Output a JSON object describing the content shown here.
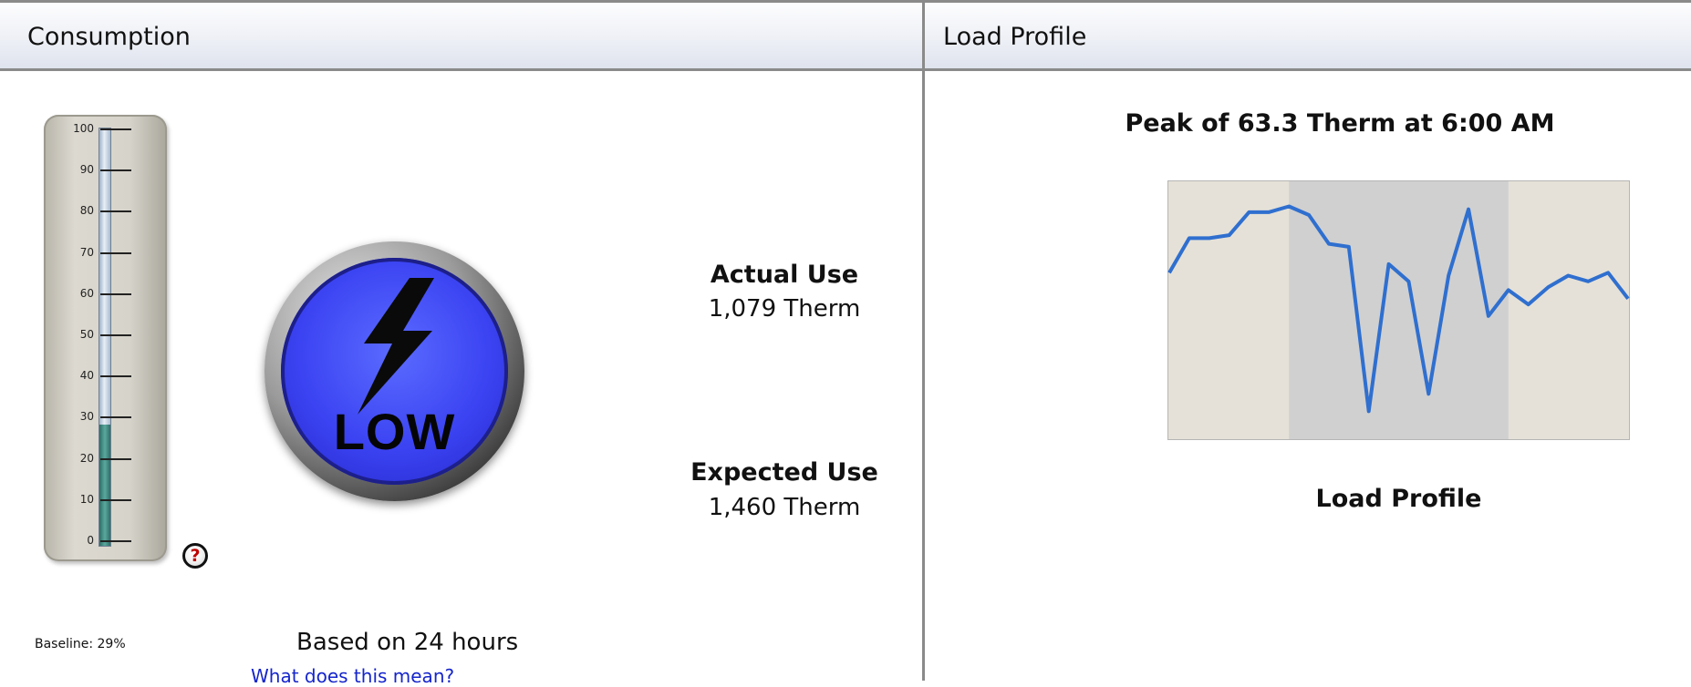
{
  "consumption": {
    "title": "Consumption",
    "thermometer": {
      "ticks": [
        "100",
        "90",
        "80",
        "70",
        "60",
        "50",
        "40",
        "30",
        "20",
        "10",
        "0"
      ],
      "level_percent": 29
    },
    "help_icon": "question-mark-icon",
    "rating_label": "LOW",
    "actual_use": {
      "label": "Actual Use",
      "value": "1,079 Therm"
    },
    "expected_use": {
      "label": "Expected Use",
      "value": "1,460 Therm"
    },
    "baseline": "Baseline: 29%",
    "based_on": "Based on 24 hours",
    "help_link": "What does this mean?"
  },
  "load_profile": {
    "title": "Load Profile",
    "peak_text": "Peak of 63.3 Therm at 6:00 AM",
    "caption": "Load Profile",
    "chart_data": {
      "type": "line",
      "series": [
        {
          "values": [
            38,
            50,
            50,
            51,
            59,
            59,
            61,
            58,
            48,
            47,
            -10,
            41,
            35,
            -4,
            37,
            60,
            23,
            32,
            27,
            33,
            37,
            35,
            38,
            29
          ]
        }
      ],
      "highlight_band": {
        "start_index": 6,
        "end_index": 17
      },
      "colors": {
        "line": "#2f6fcf",
        "background": "#e5e1d8",
        "band": "#d0d0d0"
      }
    }
  }
}
